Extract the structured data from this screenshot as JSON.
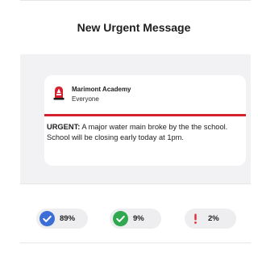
{
  "header": {
    "title": "New Urgent Message"
  },
  "message_card": {
    "sender": "Marimont Academy",
    "audience": "Everyone",
    "urgent_label": "URGENT:",
    "body": " A major water main broke by the the school. School will be closing early today at 1pm.",
    "accent_color": "#d52030"
  },
  "stats": [
    {
      "icon": "check-circle-blue-icon",
      "value": "89%",
      "color": "#3b6fd6"
    },
    {
      "icon": "check-circle-green-icon",
      "value": "9%",
      "color": "#2fa84f"
    },
    {
      "icon": "exclamation-icon",
      "value": "2%",
      "color": "#e0303a"
    }
  ]
}
